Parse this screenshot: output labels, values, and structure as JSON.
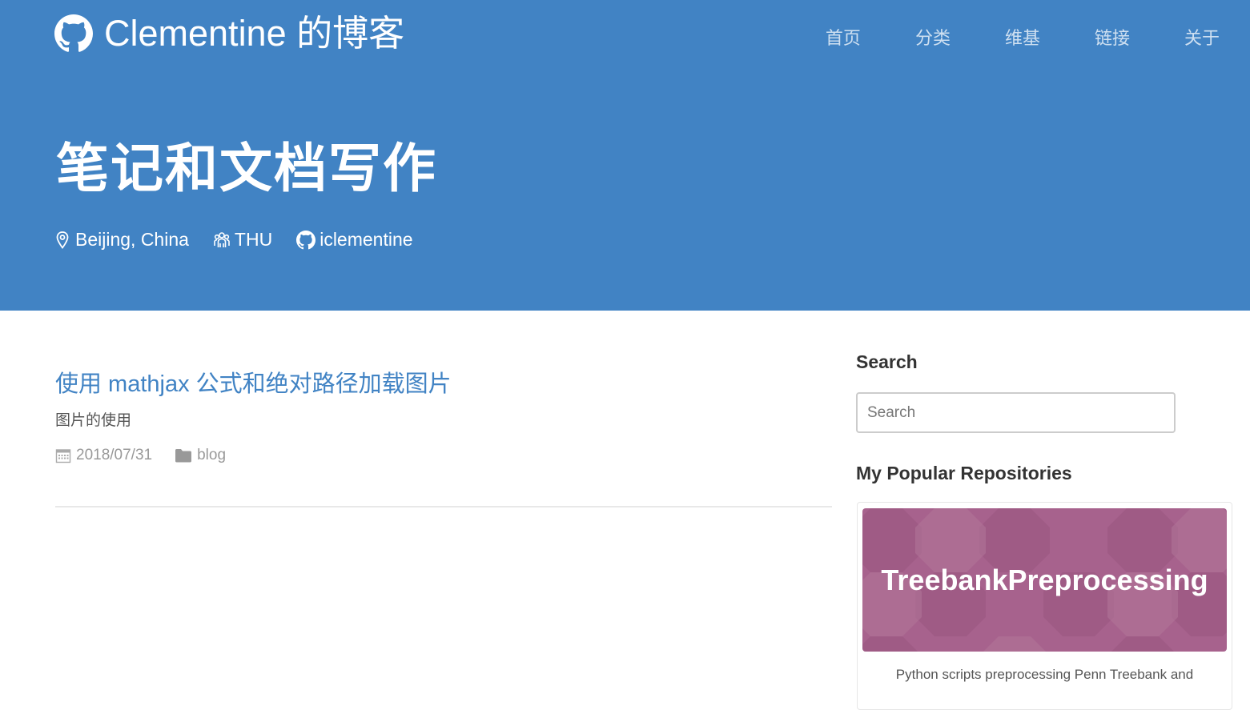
{
  "site": {
    "title": "Clementine 的博客"
  },
  "nav": {
    "items": [
      {
        "label": "首页"
      },
      {
        "label": "分类"
      },
      {
        "label": "维基"
      },
      {
        "label": "链接"
      },
      {
        "label": "关于"
      }
    ]
  },
  "hero": {
    "title": "笔记和文档写作",
    "location": "Beijing, China",
    "org": "THU",
    "github": "iclementine"
  },
  "post": {
    "title": "使用 mathjax 公式和绝对路径加载图片",
    "subtitle": "图片的使用",
    "date": "2018/07/31",
    "category": "blog"
  },
  "sidebar": {
    "search_heading": "Search",
    "search_placeholder": "Search",
    "repos_heading": "My Popular Repositories",
    "repo": {
      "name": "TreebankPreprocessing",
      "description": "Python scripts preprocessing Penn Treebank and"
    }
  },
  "colors": {
    "header_bg": "#4183c4",
    "link": "#4183c4",
    "repo_banner": "#a7628d"
  },
  "icons": [
    "github-icon",
    "map-pin-icon",
    "group-icon",
    "calendar-icon",
    "folder-icon"
  ]
}
